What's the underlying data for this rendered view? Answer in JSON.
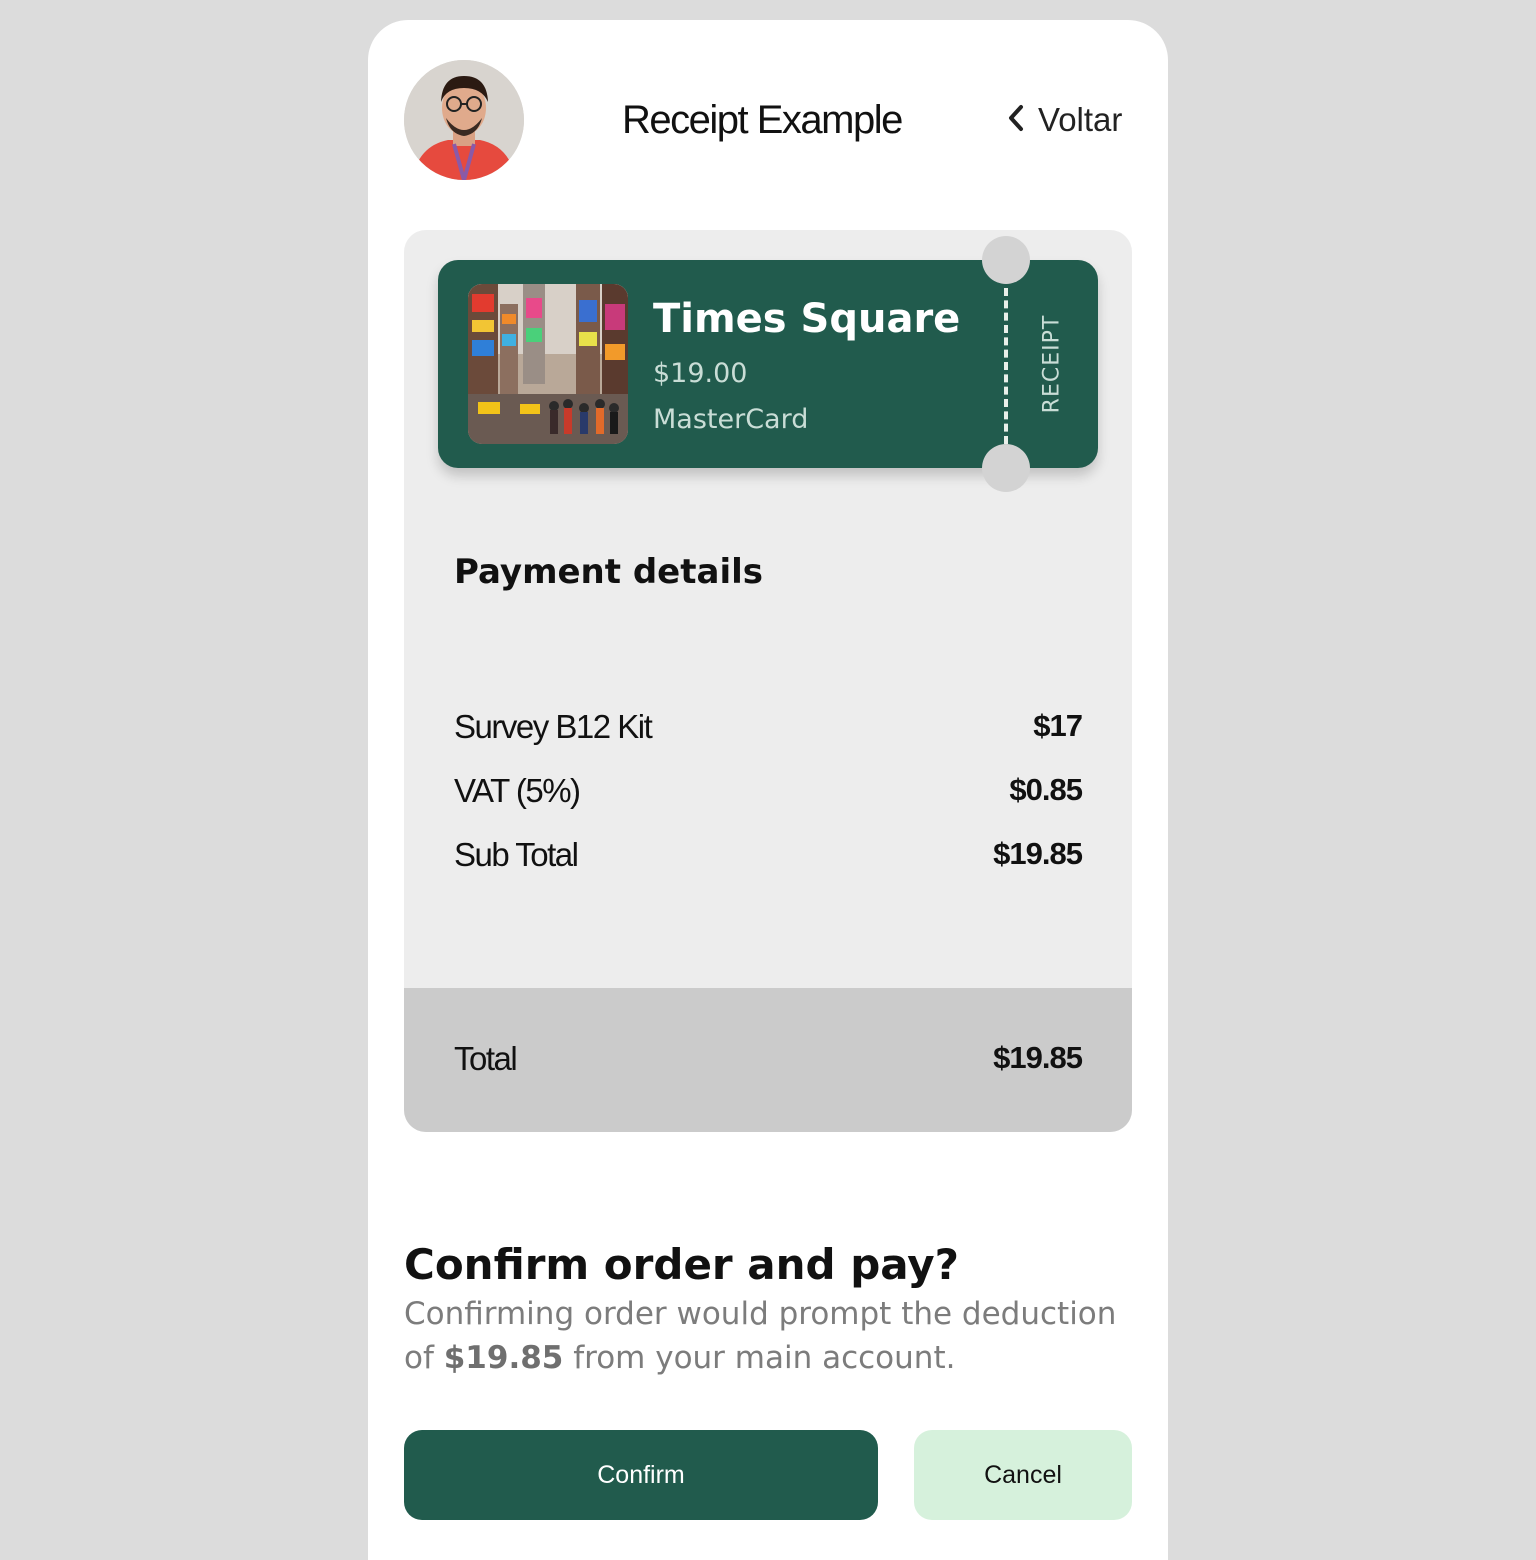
{
  "header": {
    "title": "Receipt Example",
    "back_label": "Voltar"
  },
  "ticket": {
    "name": "Times Square",
    "price": "$19.00",
    "method": "MasterCard",
    "stub_label": "RECEIPT"
  },
  "payment_details": {
    "title": "Payment details",
    "rows": [
      {
        "label": "Survey B12 Kit",
        "value": "$17"
      },
      {
        "label": "VAT (5%)",
        "value": "$0.85"
      },
      {
        "label": "Sub Total",
        "value": "$19.85"
      }
    ],
    "total": {
      "label": "Total",
      "value": "$19.85"
    }
  },
  "confirm": {
    "title": "Confirm order and pay?",
    "desc_before": "Confirming order would prompt the deduction of ",
    "desc_amount": "$19.85",
    "desc_after": " from your main account.",
    "confirm_label": "Confirm",
    "cancel_label": "Cancel"
  },
  "colors": {
    "brand": "#215b4d",
    "cancel_bg": "#d6f1dc",
    "page_bg": "#dcdcdc"
  },
  "icons": {
    "back": "chevron-left-icon",
    "avatar": "user-avatar",
    "ticket_image": "times-square-photo"
  }
}
